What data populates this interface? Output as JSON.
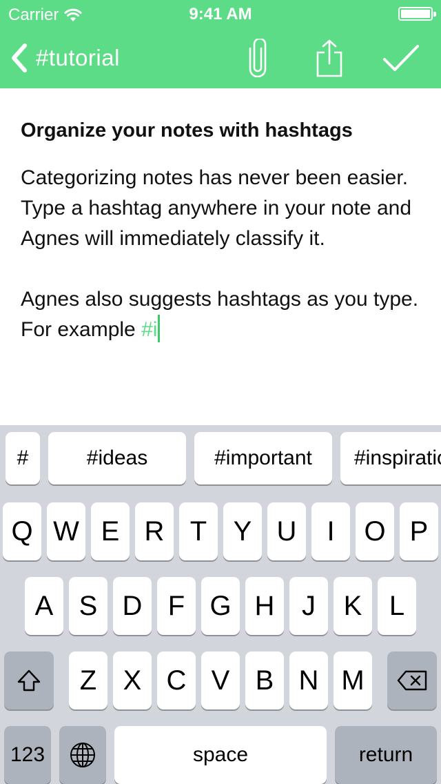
{
  "status_bar": {
    "carrier": "Carrier",
    "time": "9:41 AM",
    "wifi_icon": "wifi-icon",
    "battery_icon": "battery-icon"
  },
  "nav": {
    "back_label": "#tutorial",
    "back_icon": "chevron-left-icon",
    "attach_icon": "paperclip-icon",
    "share_icon": "share-icon",
    "done_icon": "checkmark-icon",
    "accent_color": "#5ddc87"
  },
  "note": {
    "title": "Organize your notes with hashtags",
    "paragraph_1": "Categorizing notes has never been easier. Type a hashtag anywhere in your note and Agnes will immediately classify it.",
    "paragraph_2_text": "Agnes also suggests hashtags as you type. For example ",
    "paragraph_2_hashtag": "#i"
  },
  "keyboard": {
    "hash_key": "#",
    "suggestions": [
      "#ideas",
      "#important",
      "#inspiration"
    ],
    "row_1": [
      "Q",
      "W",
      "E",
      "R",
      "T",
      "Y",
      "U",
      "I",
      "O",
      "P"
    ],
    "row_2": [
      "A",
      "S",
      "D",
      "F",
      "G",
      "H",
      "J",
      "K",
      "L"
    ],
    "row_3": [
      "Z",
      "X",
      "C",
      "V",
      "B",
      "N",
      "M"
    ],
    "shift_icon": "shift-icon",
    "delete_icon": "delete-icon",
    "numbers_label": "123",
    "globe_icon": "globe-icon",
    "space_label": "space",
    "return_label": "return"
  }
}
